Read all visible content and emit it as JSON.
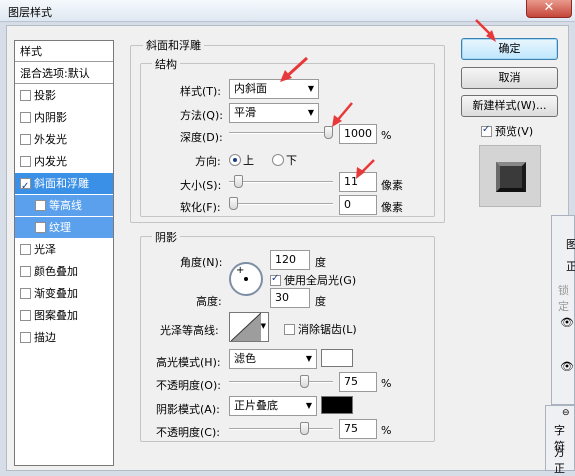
{
  "window": {
    "title": "图层样式",
    "close": "✕"
  },
  "style_list": {
    "items": [
      {
        "label": "样式",
        "checkbox": false,
        "checked": false,
        "state": "header"
      },
      {
        "label": "混合选项:默认",
        "checkbox": false,
        "checked": false,
        "state": "header"
      },
      {
        "label": "投影",
        "checkbox": true,
        "checked": false,
        "state": "normal"
      },
      {
        "label": "内阴影",
        "checkbox": true,
        "checked": false,
        "state": "normal"
      },
      {
        "label": "外发光",
        "checkbox": true,
        "checked": false,
        "state": "normal"
      },
      {
        "label": "内发光",
        "checkbox": true,
        "checked": false,
        "state": "normal"
      },
      {
        "label": "斜面和浮雕",
        "checkbox": true,
        "checked": true,
        "state": "selected"
      },
      {
        "label": "等高线",
        "checkbox": true,
        "checked": false,
        "state": "sub"
      },
      {
        "label": "纹理",
        "checkbox": true,
        "checked": false,
        "state": "sub"
      },
      {
        "label": "光泽",
        "checkbox": true,
        "checked": false,
        "state": "normal"
      },
      {
        "label": "颜色叠加",
        "checkbox": true,
        "checked": false,
        "state": "normal"
      },
      {
        "label": "渐变叠加",
        "checkbox": true,
        "checked": false,
        "state": "normal"
      },
      {
        "label": "图案叠加",
        "checkbox": true,
        "checked": false,
        "state": "normal"
      },
      {
        "label": "描边",
        "checkbox": true,
        "checked": false,
        "state": "normal"
      }
    ]
  },
  "bevel": {
    "title": "斜面和浮雕",
    "structure_title": "结构",
    "style_label": "样式(T):",
    "style_value": "内斜面",
    "technique_label": "方法(Q):",
    "technique_value": "平滑",
    "depth_label": "深度(D):",
    "depth_value": "1000",
    "depth_unit": "%",
    "depth_fraction": 1.0,
    "direction_label": "方向:",
    "direction_up": "上",
    "direction_down": "下",
    "size_label": "大小(S):",
    "size_value": "11",
    "size_unit": "像素",
    "size_fraction": 0.05,
    "soften_label": "软化(F):",
    "soften_value": "0",
    "soften_unit": "像素",
    "soften_fraction": 0.0
  },
  "shading": {
    "title": "阴影",
    "angle_label": "角度(N):",
    "angle_value": "120",
    "angle_unit": "度",
    "global_light_label": "使用全局光(G)",
    "global_light_checked": true,
    "altitude_label": "高度:",
    "altitude_value": "30",
    "altitude_unit": "度",
    "gloss_label": "光泽等高线:",
    "antialias_label": "消除锯齿(L)",
    "antialias_checked": false,
    "highlight_mode_label": "高光模式(H):",
    "highlight_mode_value": "滤色",
    "highlight_color": "#ffffff",
    "highlight_opacity_label": "不透明度(O):",
    "highlight_opacity_value": "75",
    "highlight_opacity_unit": "%",
    "highlight_opacity_fraction": 0.75,
    "shadow_mode_label": "阴影模式(A):",
    "shadow_mode_value": "正片叠底",
    "shadow_color": "#000000",
    "shadow_opacity_label": "不透明度(C):",
    "shadow_opacity_value": "75",
    "shadow_opacity_unit": "%",
    "shadow_opacity_fraction": 0.75
  },
  "buttons": {
    "ok": "确定",
    "cancel": "取消",
    "new_style": "新建样式(W)...",
    "preview_label": "预览(V)",
    "preview_checked": true
  },
  "background_panel": {
    "frag1": "图",
    "frag2": "正",
    "frag3": "锁定",
    "frag4": "字符",
    "frag5": "方正"
  },
  "colors": {
    "accent": "#3a8fe6",
    "annotation_arrow": "#e8393a"
  }
}
